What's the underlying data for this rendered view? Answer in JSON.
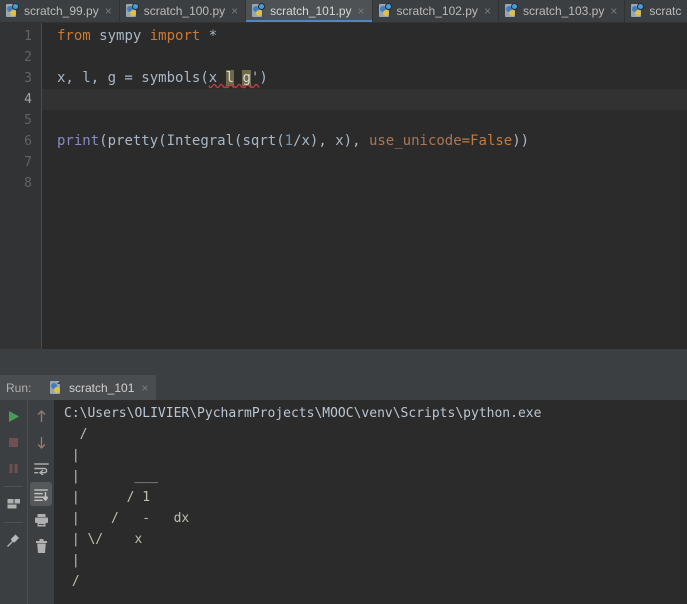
{
  "editor_tabs": [
    {
      "label": "scratch_99.py",
      "icon": "python-file-icon",
      "active": false,
      "close": "×"
    },
    {
      "label": "scratch_100.py",
      "icon": "python-file-icon",
      "active": false,
      "close": "×"
    },
    {
      "label": "scratch_101.py",
      "icon": "python-file-icon",
      "active": true,
      "close": "×"
    },
    {
      "label": "scratch_102.py",
      "icon": "python-file-icon",
      "active": false,
      "close": "×"
    },
    {
      "label": "scratch_103.py",
      "icon": "python-file-icon",
      "active": false,
      "close": "×"
    },
    {
      "label": "scratc",
      "icon": "python-file-icon",
      "active": false,
      "close": ""
    }
  ],
  "editor": {
    "line_numbers": [
      "1",
      "2",
      "3",
      "4",
      "5",
      "6",
      "7",
      "8"
    ],
    "current_line": 4,
    "lines": [
      {
        "n": "1",
        "text": "from sympy import *"
      },
      {
        "n": "2",
        "text": ""
      },
      {
        "n": "3",
        "text": "x, l, g = symbols(x l g')"
      },
      {
        "n": "4",
        "text": ""
      },
      {
        "n": "5",
        "text": ""
      },
      {
        "n": "6",
        "text": "print(pretty(Integral(sqrt(1/x), x), use_unicode=False))"
      },
      {
        "n": "7",
        "text": ""
      },
      {
        "n": "8",
        "text": ""
      }
    ]
  },
  "run_panel": {
    "label": "Run:",
    "tab_label": "scratch_101",
    "tab_close": "×",
    "left_tools": [
      {
        "name": "run-icon",
        "title": "Rerun"
      },
      {
        "name": "stop-icon",
        "title": "Stop"
      },
      {
        "name": "pause-icon",
        "title": "Pause Output"
      },
      {
        "name": "console-icon",
        "title": "Console"
      },
      {
        "name": "pin-icon",
        "title": "Pin Tab"
      }
    ],
    "right_tools": [
      {
        "name": "arrow-up-icon",
        "title": "Up the stack trace"
      },
      {
        "name": "arrow-down-icon",
        "title": "Down the stack trace"
      },
      {
        "name": "soft-wrap-icon",
        "title": "Use Soft Wraps"
      },
      {
        "name": "scroll-to-end-icon",
        "title": "Scroll to End",
        "selected": true
      },
      {
        "name": "print-icon",
        "title": "Print"
      },
      {
        "name": "trash-icon",
        "title": "Clear All"
      }
    ],
    "console_lines": [
      "C:\\Users\\OLIVIER\\PycharmProjects\\MOOC\\venv\\Scripts\\python.exe",
      "  /",
      " |",
      " |       ___",
      " |      / 1",
      " |    /   -   dx",
      " | \\/    x",
      " |",
      " /"
    ]
  },
  "colors": {
    "editor_bg": "#2b2b2b",
    "panel_bg": "#3c3f41",
    "gutter_bg": "#313335",
    "active_tab_underline": "#4a88c7",
    "keyword": "#cc7832",
    "number": "#6897bb",
    "function": "#ffc66d",
    "builtin": "#8888c6",
    "kwarg": "#aa7755",
    "identifier": "#a9b7c6",
    "search_highlight": "#6e6b4a",
    "error_squiggle": "#bc3f3c",
    "console_text": "#bbc8d4",
    "run_green": "#499c54"
  }
}
